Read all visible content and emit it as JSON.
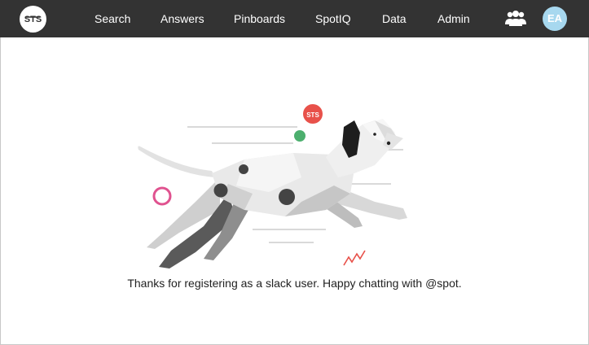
{
  "header": {
    "logo_icon": "thoughtspot-logo",
    "nav_items": [
      {
        "label": "Search"
      },
      {
        "label": "Answers"
      },
      {
        "label": "Pinboards"
      },
      {
        "label": "SpotIQ"
      },
      {
        "label": "Data"
      },
      {
        "label": "Admin"
      }
    ],
    "users_icon": "users-group-icon",
    "avatar_initials": "EA"
  },
  "main": {
    "illustration_icon": "running-dalmatian-dog",
    "message": "Thanks for registering as a slack user. Happy chatting with @spot."
  },
  "colors": {
    "navbar_bg": "#333333",
    "avatar_bg": "#a7d8ef",
    "accent_red": "#e8514a",
    "accent_green": "#4caf6e",
    "accent_pink": "#e0528f"
  }
}
